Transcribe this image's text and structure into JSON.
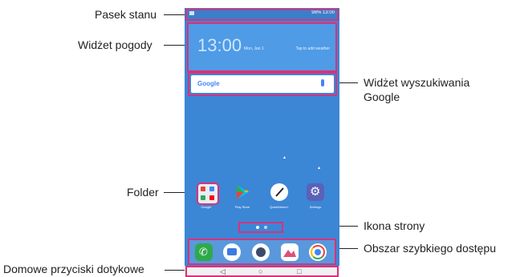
{
  "callouts": {
    "status_bar": "Pasek stanu",
    "weather_widget": "Widżet pogody",
    "google_search_widget_line1": "Widżet wyszukiwania",
    "google_search_widget_line2": "Google",
    "folder": "Folder",
    "page_icon": "Ikona strony",
    "quick_access": "Obszar szybkiego dostępu",
    "home_touch_buttons": "Domowe przyciski dotykowe"
  },
  "phone": {
    "status_text": "98% 13:00",
    "weather": {
      "time": "13:00",
      "date": "Mon, Jan 1",
      "tap_hint": "Tap to add weather"
    },
    "search": {
      "logo": "Google"
    },
    "apps": [
      {
        "label": "Google",
        "icon": "folder-icon"
      },
      {
        "label": "Play Store",
        "icon": "play-store-icon"
      },
      {
        "label": "QuickMemo+",
        "icon": "quickmemo-icon"
      },
      {
        "label": "Settings",
        "icon": "settings-icon"
      }
    ],
    "dock": [
      {
        "icon": "phone-icon"
      },
      {
        "icon": "messages-icon"
      },
      {
        "icon": "camera-icon"
      },
      {
        "icon": "gallery-icon"
      },
      {
        "icon": "chrome-icon"
      }
    ],
    "nav": {
      "back": "◁",
      "home": "○",
      "recents": "□"
    }
  },
  "colors": {
    "highlight": "#d8327a",
    "wallpaper": "#3c86d6"
  }
}
